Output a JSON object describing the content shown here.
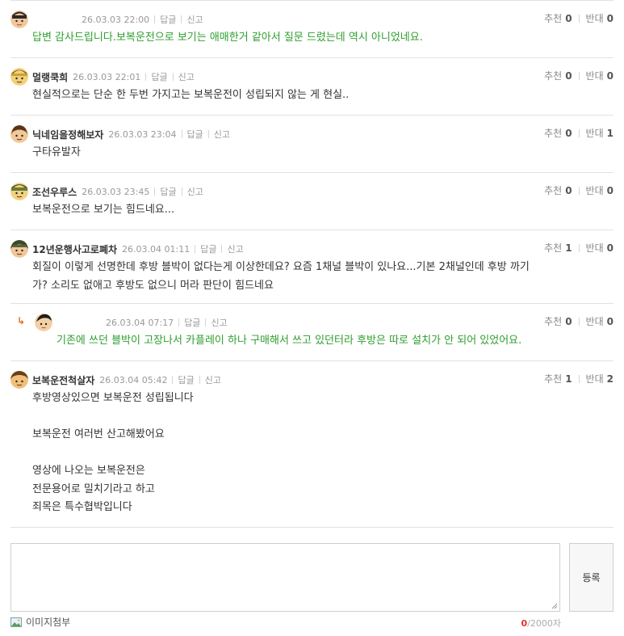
{
  "labels": {
    "reply": "답글",
    "report": "신고",
    "recommend": "추천",
    "oppose": "반대"
  },
  "comments": [
    {
      "nickname": "",
      "date": "26.03.03 22:00",
      "recommend": "0",
      "oppose": "0",
      "lines": [
        "답변 감사드립니다.보복운전으로 보기는 애매한거 같아서 질문 드렸는데 역시 아니었네요."
      ],
      "green": true
    },
    {
      "nickname": "멀랭쿡희",
      "date": "26.03.03 22:01",
      "recommend": "0",
      "oppose": "0",
      "lines": [
        "현실적으로는 단순 한 두번 가지고는 보복운전이 성립되지 않는 게 현실.."
      ]
    },
    {
      "nickname": "닉네임을정해보자",
      "date": "26.03.03 23:04",
      "recommend": "0",
      "oppose": "1",
      "lines": [
        "구타유발자"
      ]
    },
    {
      "nickname": "조선우루스",
      "date": "26.03.03 23:45",
      "recommend": "0",
      "oppose": "0",
      "lines": [
        "보복운전으로 보기는 힘드네요..."
      ]
    },
    {
      "nickname": "12년운행사고로폐차",
      "date": "26.03.04 01:11",
      "recommend": "1",
      "oppose": "0",
      "lines": [
        "회질이 이렇게 선명한데 후방 블박이 없다는게 이상한데요? 요즘 1채널 블박이 있나요...기본 2채널인데 후방 까기",
        "가? 소리도 없애고 후방도 없으니 머라 판단이 힘드네요"
      ]
    },
    {
      "nickname": "",
      "date": "26.03.04 07:17",
      "recommend": "0",
      "oppose": "0",
      "lines": [
        "기존에 쓰던 블박이 고장나서 카플레이 하나 구매해서 쓰고 있던터라 후방은 따로 설치가 안 되어 있었어요."
      ],
      "green": true,
      "is_reply": true,
      "reply_icon": "↳"
    },
    {
      "nickname": "보복운전척살자",
      "date": "26.03.04 05:42",
      "recommend": "1",
      "oppose": "2",
      "lines": [
        "후방영상있으면 보복운전 성립됩니다",
        "",
        "보복운전 여러번 산고해봤어요",
        "",
        "영상에 나오는 보복운전은",
        "전문용어로 밀치기라고 하고",
        "죄목은 특수협박입니다"
      ]
    }
  ],
  "write": {
    "textarea_value": "",
    "submit_label": "등록",
    "attach_label": "이미지첨부",
    "attach_icon": "image-icon",
    "count_current": "0",
    "count_max": "/2000자"
  },
  "colors": {
    "author_text": "#2e9e2e",
    "count_current": "#e03030",
    "reply_arrow": "#e06b1d"
  }
}
